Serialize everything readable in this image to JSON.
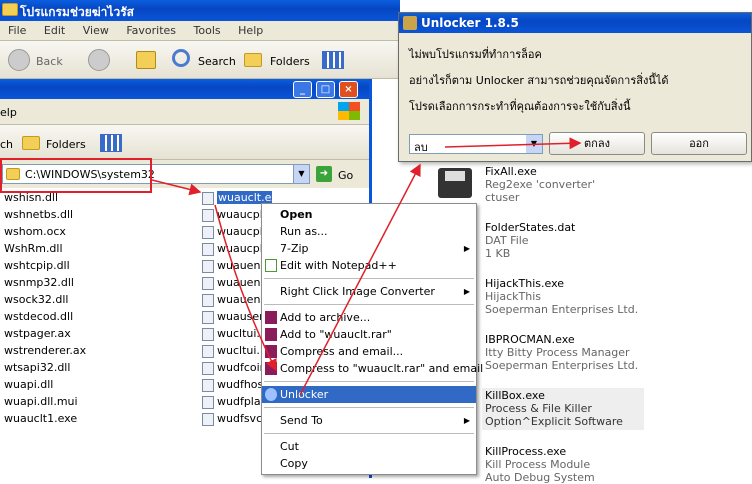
{
  "back_window": {
    "title": "โปรแกรมช่วยฆ่าไวรัส",
    "menu": [
      "File",
      "Edit",
      "View",
      "Favorites",
      "Tools",
      "Help"
    ],
    "toolbar": {
      "back_label": "Back",
      "search_label": "Search",
      "folders_label": "Folders"
    }
  },
  "front_window": {
    "menu_help": "elp",
    "toolbar_search_fragment": "ch",
    "folders_label": "Folders",
    "address": "C:\\WINDOWS\\system32",
    "go_label": "Go",
    "files_left": [
      "wshisn.dll",
      "wshnetbs.dll",
      "wshom.ocx",
      "WshRm.dll",
      "wshtcpip.dll",
      "wsnmp32.dll",
      "wsock32.dll",
      "wstdecod.dll",
      "wstpager.ax",
      "wstrenderer.ax",
      "wtsapi32.dll",
      "wuapi.dll",
      "wuapi.dll.mui",
      "wuauclt1.exe"
    ],
    "files_mid": [
      "wuauclt.exe",
      "wuaucpl",
      "wuaucpl",
      "wuaucpl",
      "wuaueng",
      "wuaueng",
      "wuaueng",
      "wuauserv",
      "wucltui.",
      "wucltui.",
      "wudfcoir",
      "wudfhos",
      "wudfplat",
      "wudfsvc"
    ]
  },
  "context_menu": {
    "items": [
      {
        "label": "Open",
        "bold": true
      },
      {
        "label": "Run as..."
      },
      {
        "label": "7-Zip",
        "submenu": true
      },
      {
        "label": "Edit with Notepad++"
      },
      {
        "sep": true
      },
      {
        "label": "Right Click Image Converter",
        "submenu": true
      },
      {
        "sep": true
      },
      {
        "label": "Add to archive..."
      },
      {
        "label": "Add to \"wuauclt.rar\""
      },
      {
        "label": "Compress and email..."
      },
      {
        "label": "Compress to \"wuauclt.rar\" and email"
      },
      {
        "sep": true
      },
      {
        "label": "Unlocker",
        "selected": true
      },
      {
        "sep": true
      },
      {
        "label": "Send To",
        "submenu": true
      },
      {
        "sep": true
      },
      {
        "label": "Cut"
      },
      {
        "label": "Copy"
      }
    ]
  },
  "right_panel": [
    {
      "name": "FixAll.exe",
      "line2": "Reg2exe 'converter'",
      "line3": "ctuser"
    },
    {
      "name": "FolderStates.dat",
      "line2": "DAT File",
      "line3": "1 KB"
    },
    {
      "name": "HijackThis.exe",
      "line2": "HijackThis",
      "line3": "Soeperman Enterprises Ltd."
    },
    {
      "name": "IBPROCMAN.exe",
      "line2": "Itty Bitty Process Manager",
      "line3": "Soeperman Enterprises Ltd."
    },
    {
      "name": "KillBox.exe",
      "line2": "Process & File Killer",
      "line3": "Option^Explicit Software"
    },
    {
      "name": "KillProcess.exe",
      "line2": "Kill Process Module",
      "line3": "Auto Debug System"
    }
  ],
  "unlocker": {
    "title": "Unlocker 1.8.5",
    "line1": "ไม่พบโปรแกรมที่ทำการล็อค",
    "line2": "อย่างไรก็ตาม Unlocker สามารถช่วยคุณจัดการสิ่งนี้ได้",
    "line3": "โปรดเลือกการกระทำที่คุณต้องการจะใช้กับสิ่งนี้",
    "action_value": "ลบ",
    "ok_label": "ตกลง",
    "exit_label": "ออก"
  },
  "colors": {
    "xp_blue": "#0a55d8",
    "highlight": "#316ac5",
    "annotation_red": "#e0202a"
  }
}
